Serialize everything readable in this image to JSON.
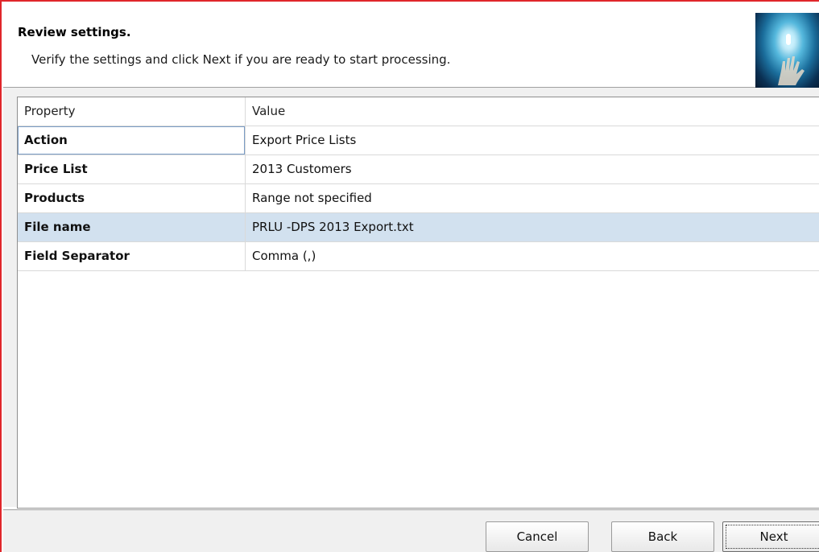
{
  "header": {
    "title": "Review settings.",
    "subtitle": "Verify the settings and click Next if you are ready to start processing."
  },
  "grid": {
    "columns": [
      "Property",
      "Value"
    ],
    "rows": [
      {
        "property": "Action",
        "value": "Export Price Lists"
      },
      {
        "property": "Price List",
        "value": "2013 Customers"
      },
      {
        "property": "Products",
        "value": "Range not specified"
      },
      {
        "property": "File name",
        "value": "PRLU -DPS 2013 Export.txt"
      },
      {
        "property": "Field Separator",
        "value": "Comma (,)"
      }
    ],
    "selected_row_index": 3
  },
  "buttons": {
    "cancel": "Cancel",
    "back": "Back",
    "next": "Next"
  },
  "colors": {
    "window_border": "#e0262b",
    "selected_row": "#d2e1ef",
    "panel_background": "#f0f0f0"
  }
}
